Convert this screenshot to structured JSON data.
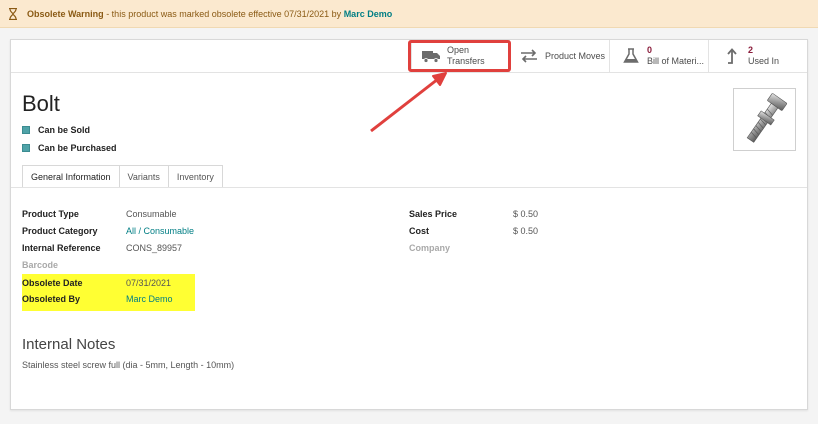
{
  "warning": {
    "title": "Obsolete Warning",
    "message": "- this product was marked obsolete effective 07/31/2021 by",
    "user": "Marc Demo",
    "icon": "hourglass-icon"
  },
  "smart_buttons": {
    "open_transfers": {
      "line1": "Open",
      "line2": "Transfers",
      "icon": "truck-icon"
    },
    "product_moves": {
      "label": "Product Moves",
      "icon": "exchange-arrows-icon"
    },
    "bill_of_materials": {
      "count": "0",
      "label": "Bill of Materi...",
      "icon": "flask-icon"
    },
    "used_in": {
      "count": "2",
      "label": "Used In",
      "icon": "level-up-icon"
    }
  },
  "product": {
    "name": "Bolt",
    "can_be_sold": "Can be Sold",
    "can_be_purchased": "Can be Purchased",
    "image": "bolt-screw-image"
  },
  "tabs": [
    "General Information",
    "Variants",
    "Inventory"
  ],
  "fields_left": [
    {
      "label": "Product Type",
      "value": "Consumable"
    },
    {
      "label": "Product Category",
      "value": "All / Consumable"
    },
    {
      "label": "Internal Reference",
      "value": "CONS_89957"
    },
    {
      "label": "Barcode",
      "value": ""
    },
    {
      "label": "Obsolete Date",
      "value": "07/31/2021"
    },
    {
      "label": "Obsoleted By",
      "value": "Marc Demo"
    }
  ],
  "fields_right": [
    {
      "label": "Sales Price",
      "value": "$ 0.50"
    },
    {
      "label": "Cost",
      "value": "$ 0.50"
    },
    {
      "label": "Company",
      "value": ""
    }
  ],
  "notes": {
    "heading": "Internal Notes",
    "text": "Stainless steel screw full (dia - 5mm, Length - 10mm)"
  },
  "colors": {
    "accent": "#017e84",
    "highlight": "#ffff33",
    "annotation": "#e0403d",
    "warning_bg": "#fbe9cf"
  }
}
